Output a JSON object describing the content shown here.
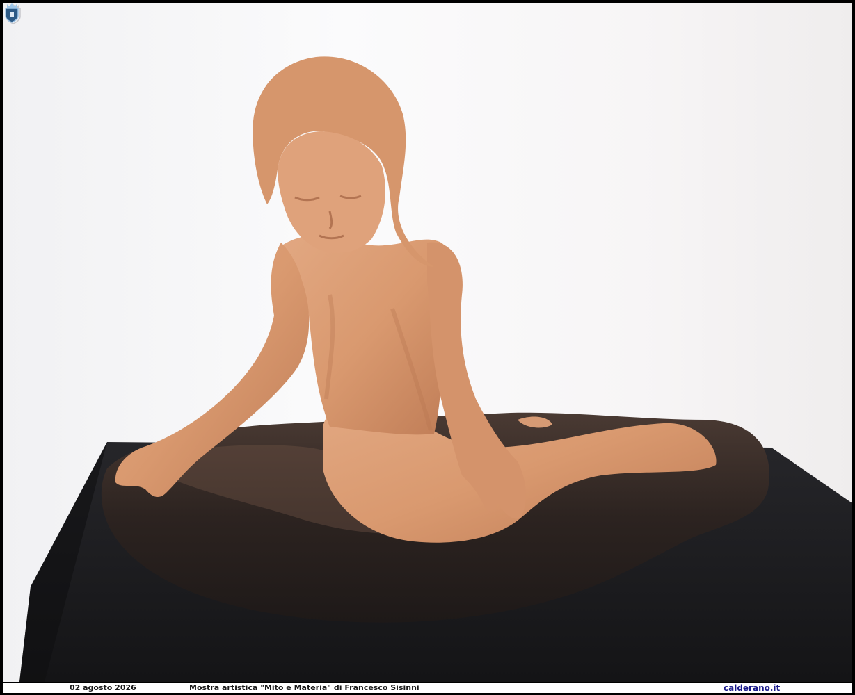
{
  "caption": {
    "date": "02 agosto 2026",
    "title": "Mostra artistica \"Mito e Materia\" di Francesco Sisinni",
    "site": "calderano.it"
  },
  "image": {
    "icons": [
      "coat-of-arms-watermark-icon",
      "coat-of-arms-logo-icon"
    ],
    "colors": {
      "wall": "#f5f4f5",
      "pedestal": "#1c1c1e",
      "base_stone": "#2f2623",
      "terracotta": "#d99c74",
      "terracotta_shadow": "#b77652",
      "caption_bar": "#ffffff"
    }
  }
}
